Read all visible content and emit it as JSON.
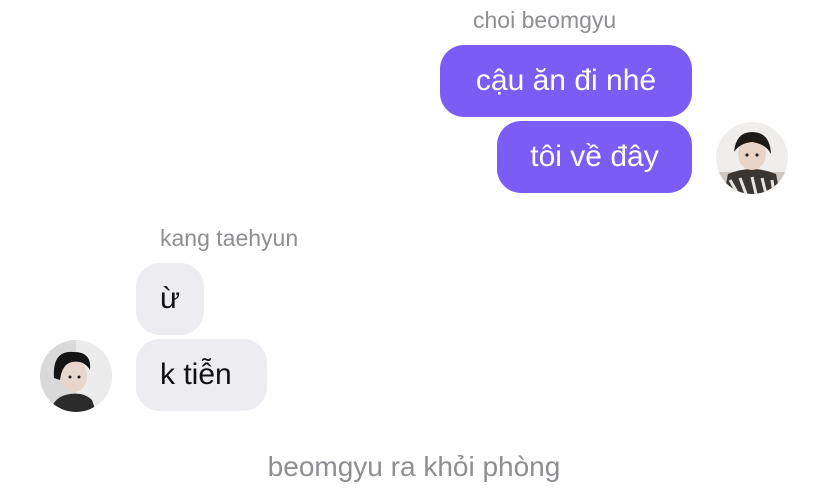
{
  "outgoing": {
    "sender": "choi beomgyu",
    "messages": [
      "cậu ăn đi nhé",
      "tôi về đây"
    ],
    "bubble_color": "#7b5cf5",
    "avatar_icon": "user-photo-avatar"
  },
  "incoming": {
    "sender": "kang taehyun",
    "messages": [
      "ừ",
      "k tiễn"
    ],
    "bubble_color": "#ececf1",
    "avatar_icon": "user-photo-avatar"
  },
  "system_message": "beomgyu ra khỏi phòng"
}
